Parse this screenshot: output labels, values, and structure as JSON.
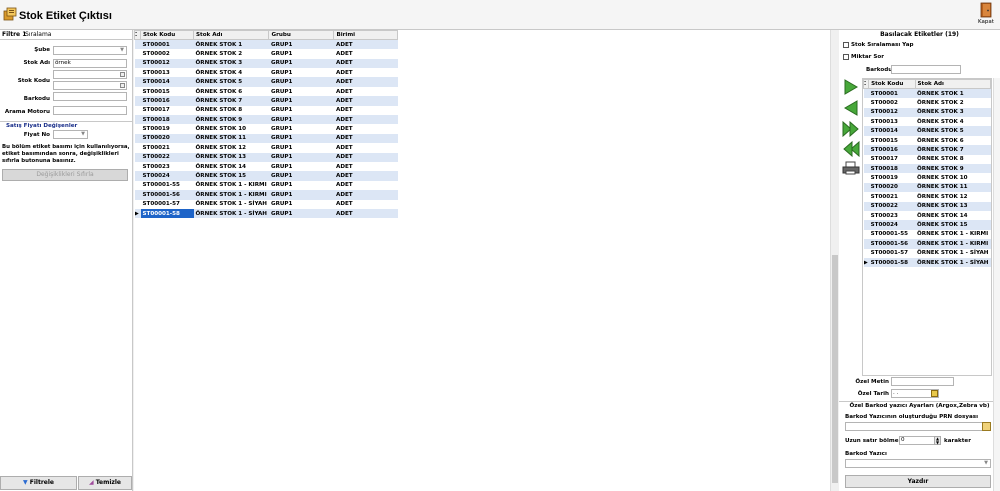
{
  "window": {
    "title": "Stok Etiket Çıktısı",
    "close_label": "Kapat"
  },
  "left": {
    "tabs": [
      "Filtre 1",
      "Sıralama"
    ],
    "fields": [
      {
        "label": "Şube",
        "value": ""
      },
      {
        "label": "Stok Adı",
        "value": "örnek"
      },
      {
        "label": "Stok Kodu",
        "value": ""
      },
      {
        "label": "Barkodu",
        "value": ""
      },
      {
        "label": "Arama Motoru",
        "value": ""
      }
    ],
    "price_section": "Satış Fiyatı Değişenler",
    "price_no_label": "Fiyat No",
    "info": "Bu bölüm etiket basımı için kullanılıyorsa, etiket basımından sonra, değişiklikleri sıfırla butonuna basınız.",
    "reset_button": "Değişiklikleri Sıfırla",
    "filter_button": "Filtrele",
    "clear_button": "Temizle"
  },
  "grid": {
    "columns": [
      "Stok Kodu",
      "Stok Adı",
      "Grubu",
      "Birimi"
    ],
    "rows": [
      [
        "ST00001",
        "ÖRNEK STOK 1",
        "GRUP1",
        "ADET"
      ],
      [
        "ST00002",
        "ÖRNEK STOK 2",
        "GRUP1",
        "ADET"
      ],
      [
        "ST00012",
        "ÖRNEK STOK 3",
        "GRUP1",
        "ADET"
      ],
      [
        "ST00013",
        "ÖRNEK STOK 4",
        "GRUP1",
        "ADET"
      ],
      [
        "ST00014",
        "ÖRNEK STOK 5",
        "GRUP1",
        "ADET"
      ],
      [
        "ST00015",
        "ÖRNEK STOK 6",
        "GRUP1",
        "ADET"
      ],
      [
        "ST00016",
        "ÖRNEK STOK 7",
        "GRUP1",
        "ADET"
      ],
      [
        "ST00017",
        "ÖRNEK STOK 8",
        "GRUP1",
        "ADET"
      ],
      [
        "ST00018",
        "ÖRNEK STOK 9",
        "GRUP1",
        "ADET"
      ],
      [
        "ST00019",
        "ÖRNEK STOK 10",
        "GRUP1",
        "ADET"
      ],
      [
        "ST00020",
        "ÖRNEK STOK 11",
        "GRUP1",
        "ADET"
      ],
      [
        "ST00021",
        "ÖRNEK STOK 12",
        "GRUP1",
        "ADET"
      ],
      [
        "ST00022",
        "ÖRNEK STOK 13",
        "GRUP1",
        "ADET"
      ],
      [
        "ST00023",
        "ÖRNEK STOK 14",
        "GRUP1",
        "ADET"
      ],
      [
        "ST00024",
        "ÖRNEK STOK 15",
        "GRUP1",
        "ADET"
      ],
      [
        "ST00001-55",
        "ÖRNEK STOK 1 - KIRMI",
        "GRUP1",
        "ADET"
      ],
      [
        "ST00001-56",
        "ÖRNEK STOK 1 - KIRMI",
        "GRUP1",
        "ADET"
      ],
      [
        "ST00001-57",
        "ÖRNEK STOK 1 - SİYAH",
        "GRUP1",
        "ADET"
      ],
      [
        "ST00001-58",
        "ÖRNEK STOK 1 - SİYAH",
        "GRUP1",
        "ADET"
      ]
    ]
  },
  "right": {
    "title": "Basılacak Etiketler (19)",
    "sort_check": "Stok Sıralaması Yap",
    "qty_check": "Miktar Sor",
    "barcode_label": "Barkodu",
    "columns": [
      "Stok Kodu",
      "Stok Adı"
    ],
    "rows": [
      [
        "ST00001",
        "ÖRNEK STOK 1"
      ],
      [
        "ST00002",
        "ÖRNEK STOK 2"
      ],
      [
        "ST00012",
        "ÖRNEK STOK 3"
      ],
      [
        "ST00013",
        "ÖRNEK STOK 4"
      ],
      [
        "ST00014",
        "ÖRNEK STOK 5"
      ],
      [
        "ST00015",
        "ÖRNEK STOK 6"
      ],
      [
        "ST00016",
        "ÖRNEK STOK 7"
      ],
      [
        "ST00017",
        "ÖRNEK STOK 8"
      ],
      [
        "ST00018",
        "ÖRNEK STOK 9"
      ],
      [
        "ST00019",
        "ÖRNEK STOK 10"
      ],
      [
        "ST00020",
        "ÖRNEK STOK 11"
      ],
      [
        "ST00021",
        "ÖRNEK STOK 12"
      ],
      [
        "ST00022",
        "ÖRNEK STOK 13"
      ],
      [
        "ST00023",
        "ÖRNEK STOK 14"
      ],
      [
        "ST00024",
        "ÖRNEK STOK 15"
      ],
      [
        "ST00001-55",
        "ÖRNEK STOK 1 - KIRMI"
      ],
      [
        "ST00001-56",
        "ÖRNEK STOK 1 - KIRMI"
      ],
      [
        "ST00001-57",
        "ÖRNEK STOK 1 - SİYAH"
      ],
      [
        "ST00001-58",
        "ÖRNEK STOK 1 - SİYAH"
      ]
    ],
    "special_text_label": "Özel Metin",
    "special_date_label": "Özel Tarih",
    "special_date_value": ". .",
    "printer_section": "Özel Barkod yazıcı Ayarları (Argox,Zebra vb)",
    "prn_label": "Barkod Yazıcının oluşturduğu PRN dosyası",
    "split_label": "Uzun satır bölme",
    "split_value": "0",
    "split_unit": "karakter",
    "printer_label": "Barkod Yazıcı",
    "print_button": "Yazdır"
  }
}
